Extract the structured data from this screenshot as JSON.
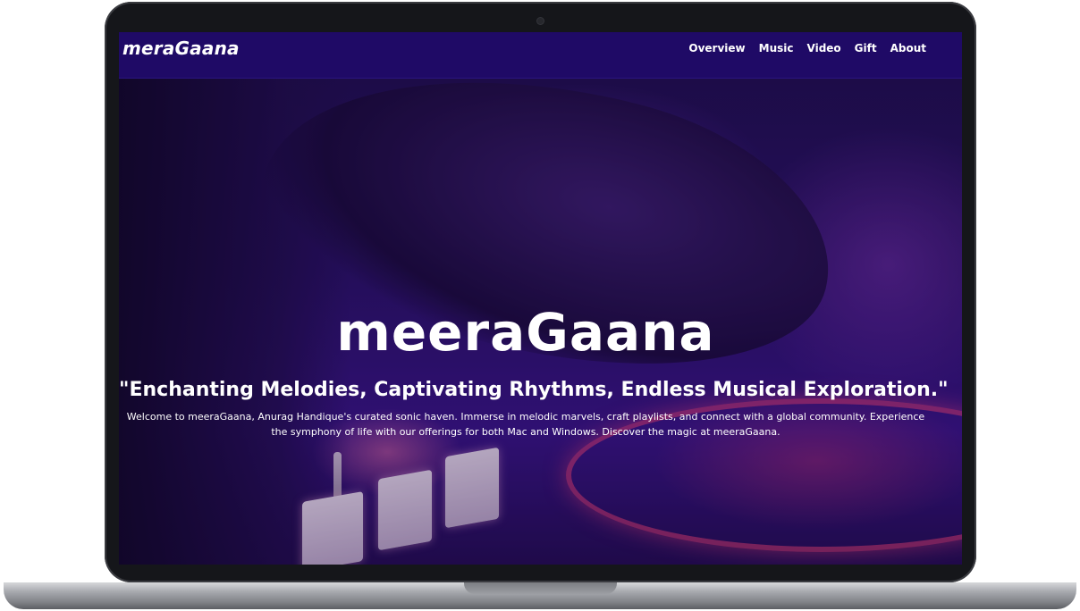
{
  "site": {
    "brand": "meraGaana"
  },
  "nav": {
    "items": [
      {
        "label": "Overview"
      },
      {
        "label": "Music"
      },
      {
        "label": "Video"
      },
      {
        "label": "Gift"
      },
      {
        "label": "About"
      }
    ]
  },
  "hero": {
    "title": "meeraGaana",
    "tagline": "\"Enchanting Melodies, Captivating Rhythms, Endless Musical Exploration.\"",
    "description": "Welcome to meeraGaana, Anurag Handique's curated sonic haven. Immerse in melodic marvels, craft playlists, and connect with a global community. Experience the symphony of life with our offerings for both Mac and Windows. Discover the magic at meeraGaana."
  },
  "colors": {
    "nav_background": "#1f0a66",
    "hero_tint": "#2a1168",
    "laptop_frame": "#15161a",
    "text": "#ffffff"
  }
}
